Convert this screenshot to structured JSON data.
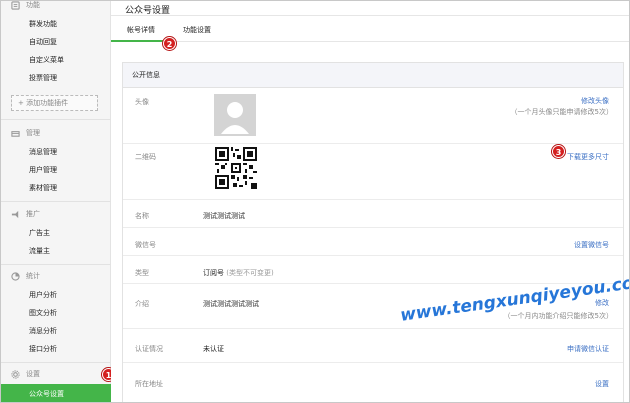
{
  "sidebar": {
    "sections": [
      {
        "title": "功能",
        "icon": "function-icon",
        "items": [
          "群发功能",
          "自动回复",
          "自定义菜单",
          "投票管理"
        ]
      },
      {
        "title": "管理",
        "icon": "manage-icon",
        "items": [
          "消息管理",
          "用户管理",
          "素材管理"
        ]
      },
      {
        "title": "推广",
        "icon": "promote-icon",
        "items": [
          "广告主",
          "流量主"
        ]
      },
      {
        "title": "统计",
        "icon": "stats-icon",
        "items": [
          "用户分析",
          "图文分析",
          "消息分析",
          "接口分析"
        ]
      },
      {
        "title": "设置",
        "icon": "settings-icon",
        "items": [
          "公众号设置"
        ]
      }
    ],
    "add_plugin_label": "+ 添加功能插件"
  },
  "main": {
    "page_title": "公众号设置",
    "tabs": [
      {
        "label": "帐号详情",
        "active": true
      },
      {
        "label": "功能设置",
        "active": false
      }
    ],
    "panel_title": "公开信息",
    "rows": {
      "avatar": {
        "label": "头像",
        "link": "修改头像",
        "note": "（一个月头像只能申请修改5次）"
      },
      "qrcode": {
        "label": "二维码",
        "link": "下载更多尺寸"
      },
      "name": {
        "label": "名称",
        "value": "测试测试测试"
      },
      "wechat_id": {
        "label": "微信号",
        "link": "设置微信号"
      },
      "type": {
        "label": "类型",
        "value": "订阅号",
        "sub": "(类型不可变更)"
      },
      "intro": {
        "label": "介绍",
        "value": "测试测试测试测试",
        "link": "修改",
        "note": "（一个月内功能介绍只能修改5次）"
      },
      "verify": {
        "label": "认证情况",
        "value": "未认证",
        "link": "申请微信认证"
      },
      "address": {
        "label": "所在地址",
        "link": "设置"
      }
    }
  },
  "markers": [
    "1",
    "2",
    "3"
  ],
  "watermark": "www.tengxunqiyeyou.com",
  "colors": {
    "accent": "#44b549",
    "link": "#3a6fc4",
    "marker": "#d42020",
    "watermark": "#1b6fd6"
  }
}
